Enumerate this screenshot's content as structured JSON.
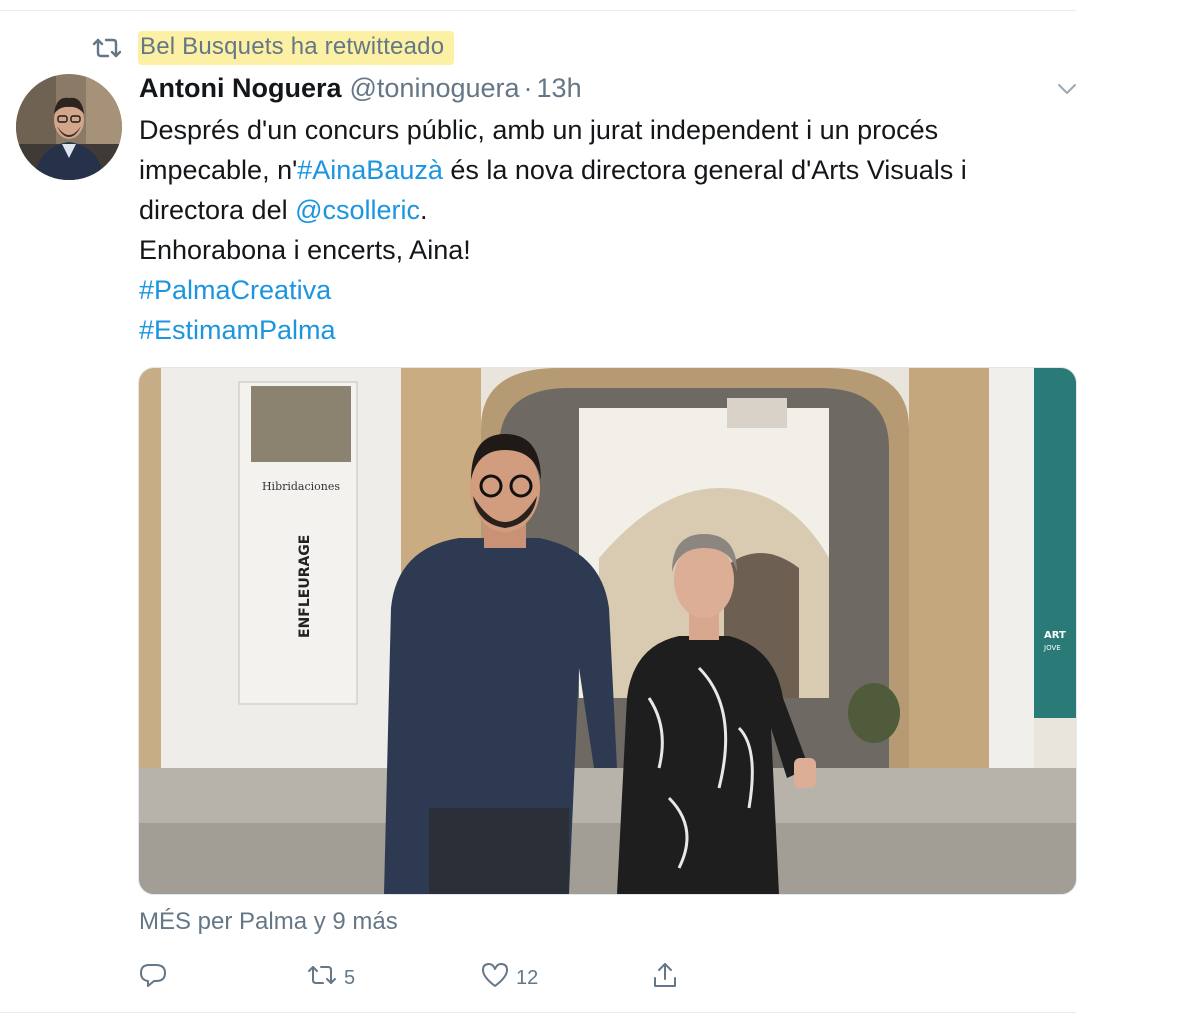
{
  "retweet_context": {
    "icon": "retweet-icon",
    "text": "Bel Busquets ha retwitteado",
    "highlight_color": "#fbf0a3"
  },
  "tweet": {
    "author_name": "Antoni Noguera",
    "author_handle": "@toninoguera",
    "separator": "·",
    "timestamp": "13h",
    "menu_icon": "chevron-down-icon",
    "body": {
      "line1": "Després d'un concurs públic, amb un jurat independent i un procés",
      "line2_pre": "impecable, n'",
      "line2_hashtag": "#AinaBauzà",
      "line2_post": " és la nova directora general d'Arts Visuals i",
      "line3_pre": "directora del ",
      "line3_mention": "@csolleric",
      "line3_post": ".",
      "line4": "Enhorabona i encerts, Aina!",
      "hashtag1": "#PalmaCreativa",
      "hashtag2": "#EstimamPalma"
    },
    "media": {
      "poster_title": "Hibridaciones",
      "poster_vertical_text": "ENFLEURAGE",
      "side_banner_text_1": "ART",
      "side_banner_text_2": "JOVE"
    },
    "social_context": "MÉS per Palma y 9 más",
    "actions": {
      "reply_icon": "reply-icon",
      "retweet_icon": "retweet-icon",
      "retweet_count": "5",
      "like_icon": "heart-icon",
      "like_count": "12",
      "share_icon": "share-icon"
    }
  },
  "colors": {
    "link": "#1b95e0",
    "secondary_text": "#657786",
    "primary_text": "#14171a"
  }
}
